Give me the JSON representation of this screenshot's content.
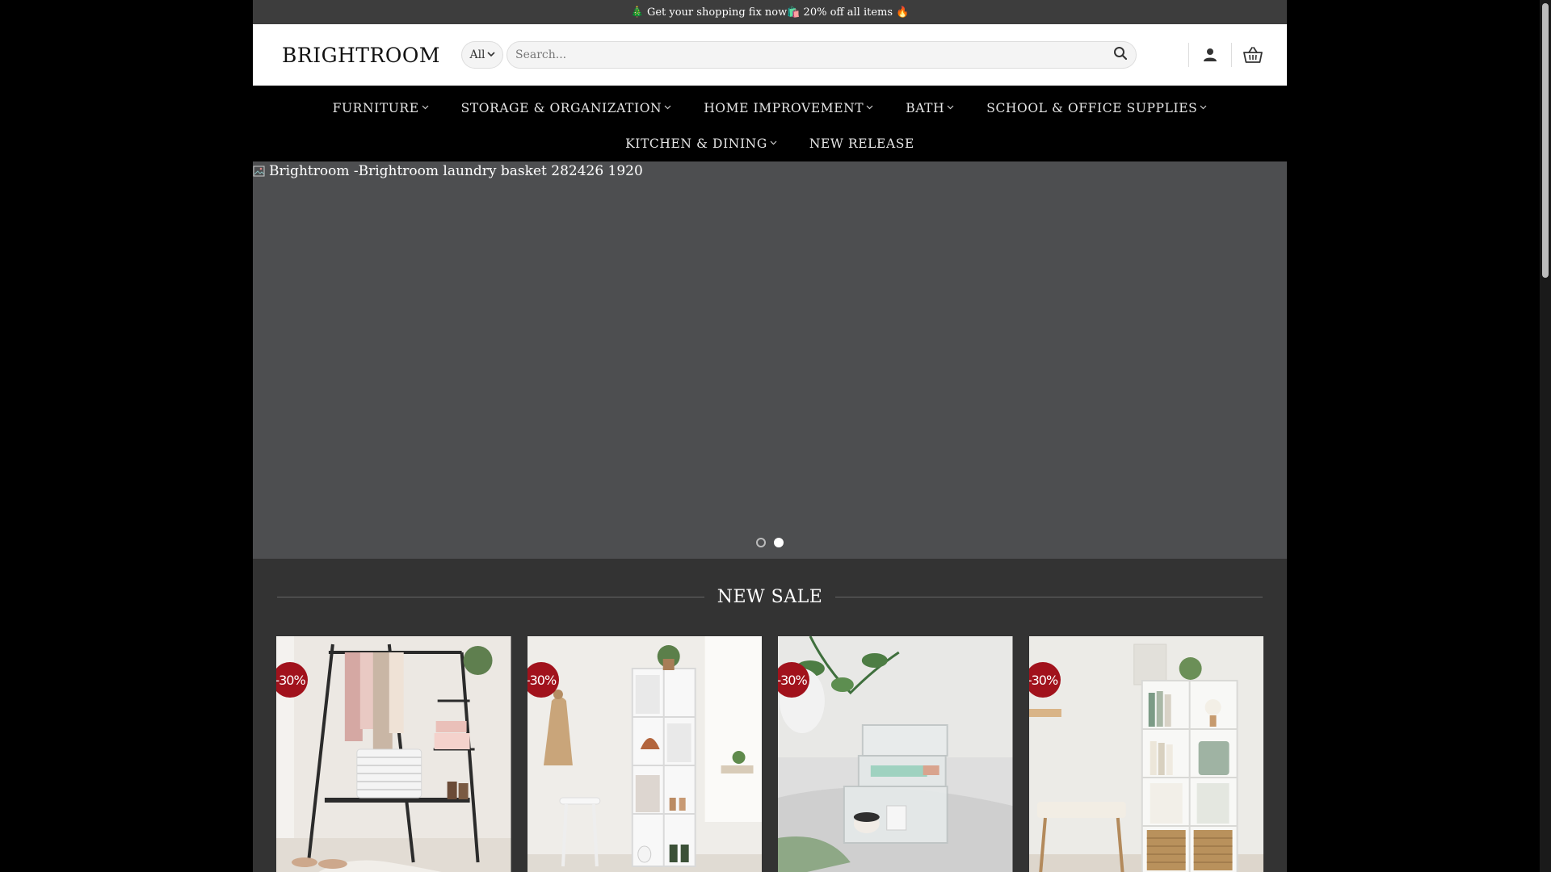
{
  "topbar": {
    "announcement": "🎄 Get your shopping fix now🛍️ 20% off all items 🔥"
  },
  "header": {
    "logo": "BRIGHTROOM",
    "category_select": "All",
    "search_placeholder": "Search..."
  },
  "nav": {
    "row1": [
      {
        "label": "FURNITURE"
      },
      {
        "label": "STORAGE & ORGANIZATION"
      },
      {
        "label": "HOME IMPROVEMENT"
      },
      {
        "label": "BATH"
      },
      {
        "label": "SCHOOL & OFFICE SUPPLIES"
      }
    ],
    "row2": [
      {
        "label": "KITCHEN & DINING"
      },
      {
        "label": "NEW RELEASE"
      }
    ]
  },
  "hero": {
    "alt_text": "Brightroom -Brightroom laundry basket 282426 1920",
    "active_slide": 2,
    "slide_count": 2
  },
  "section": {
    "title": "NEW SALE"
  },
  "products": [
    {
      "badge": "-30%"
    },
    {
      "badge": "-30%"
    },
    {
      "badge": "-30%"
    },
    {
      "badge": "-30%"
    }
  ],
  "colors": {
    "badge": "#a1121c",
    "hero_bg": "#4d4e50",
    "page_bg": "#333333"
  }
}
